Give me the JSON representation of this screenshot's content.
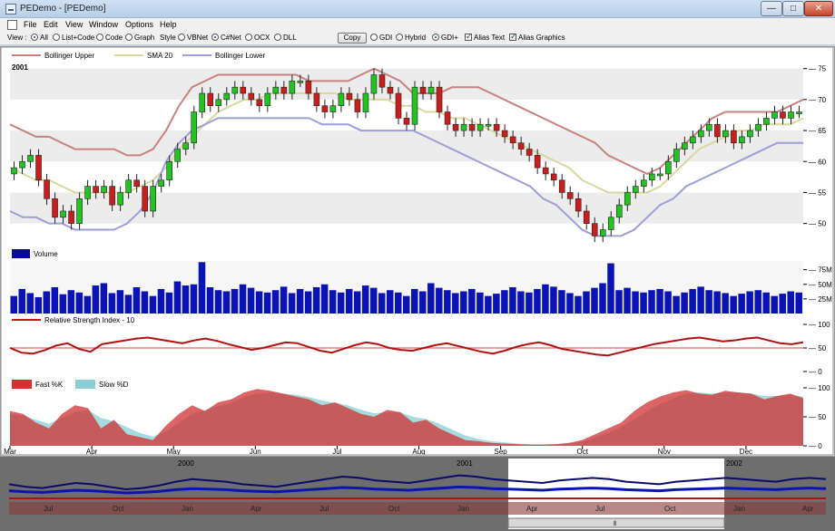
{
  "window": {
    "title": "PEDemo - [PEDemo]",
    "controls": {
      "minimize": "—",
      "maximize": "□",
      "close": "✕"
    }
  },
  "menu": [
    "File",
    "Edit",
    "View",
    "Window",
    "Options",
    "Help"
  ],
  "toolbar": {
    "view_label": "View :",
    "view_options": [
      {
        "label": "All",
        "selected": true
      },
      {
        "label": "List+Code",
        "selected": false
      },
      {
        "label": "Code",
        "selected": false
      },
      {
        "label": "Graph",
        "selected": false
      }
    ],
    "style_label": "Style :",
    "style_options": [
      {
        "label": "VBNet",
        "selected": false
      },
      {
        "label": "C#Net",
        "selected": true
      },
      {
        "label": "OCX",
        "selected": false
      },
      {
        "label": "DLL",
        "selected": false
      }
    ],
    "copy_label": "Copy",
    "render_options": [
      {
        "label": "GDI",
        "selected": false
      },
      {
        "label": "Hybrid",
        "selected": false
      },
      {
        "label": "GDI+",
        "selected": true
      }
    ],
    "alias_text_label": "Alias Text",
    "alias_text_checked": true,
    "alias_graphics_label": "Alias Graphics",
    "alias_graphics_checked": true
  },
  "chart_data": [
    {
      "type": "line",
      "panel": "price",
      "year_label": "2001",
      "legend": [
        "Bollinger Upper",
        "SMA 20",
        "Bollinger Lower"
      ],
      "ylim": [
        46,
        77
      ],
      "y_ticks": [
        50,
        55,
        60,
        65,
        70,
        75
      ],
      "x_months": [
        "Mar",
        "Apr",
        "May",
        "Jun",
        "Jul",
        "Aug",
        "Sep",
        "Oct",
        "Nov",
        "Dec"
      ],
      "close": [
        59,
        60,
        61,
        57,
        54,
        51,
        52,
        50,
        54,
        56,
        55,
        56,
        53,
        55,
        57,
        56,
        52,
        56,
        57,
        60,
        62,
        63,
        68,
        71,
        69,
        70,
        71,
        72,
        71,
        70,
        69,
        71,
        72,
        71,
        73,
        73,
        71,
        69,
        68,
        69,
        71,
        70,
        68,
        71,
        74,
        72,
        71,
        67,
        66,
        72,
        71,
        72,
        68,
        66,
        65,
        66,
        65,
        66,
        66,
        65,
        64,
        63,
        62,
        61,
        59,
        58,
        57,
        55,
        54,
        52,
        50,
        48,
        49,
        51,
        53,
        55,
        56,
        57,
        58,
        58,
        60,
        62,
        63,
        64,
        65,
        66,
        64,
        65,
        63,
        64,
        65,
        66,
        67,
        68,
        67,
        68,
        68
      ],
      "series": [
        {
          "name": "Bollinger Upper",
          "color": "#c98080",
          "values": [
            66,
            65,
            64,
            64,
            63,
            62,
            62,
            62,
            62,
            61,
            61,
            62,
            65,
            69,
            72,
            73,
            74,
            74,
            74,
            74,
            74,
            74,
            74,
            73,
            73,
            73,
            73,
            74,
            75,
            74,
            73,
            71,
            71,
            71,
            72,
            72,
            72,
            71,
            70,
            69,
            68,
            67,
            66,
            65,
            64,
            63,
            61,
            60,
            59,
            58,
            59,
            61,
            63,
            65,
            67,
            68,
            68,
            68,
            68,
            68,
            69,
            70
          ]
        },
        {
          "name": "SMA 20",
          "color": "#d8d8a0",
          "values": [
            59,
            58,
            57,
            57,
            56,
            55,
            55,
            55,
            55,
            55,
            56,
            57,
            59,
            62,
            64,
            66,
            68,
            69,
            70,
            70,
            71,
            71,
            71,
            71,
            71,
            71,
            70,
            70,
            70,
            70,
            69,
            69,
            68,
            68,
            67,
            67,
            66,
            65,
            64,
            63,
            62,
            61,
            60,
            59,
            57,
            56,
            55,
            55,
            55,
            55,
            56,
            58,
            60,
            62,
            63,
            64,
            65,
            65,
            66,
            66,
            66,
            67
          ]
        },
        {
          "name": "Bollinger Lower",
          "color": "#9e9ed8",
          "values": [
            52,
            51,
            51,
            50,
            50,
            49,
            49,
            49,
            49,
            50,
            52,
            55,
            60,
            63,
            65,
            66,
            67,
            67,
            67,
            67,
            67,
            67,
            67,
            67,
            66,
            66,
            66,
            65,
            65,
            65,
            65,
            65,
            64,
            63,
            62,
            61,
            60,
            59,
            58,
            57,
            56,
            54,
            53,
            51,
            49,
            48,
            48,
            48,
            49,
            51,
            53,
            54,
            56,
            57,
            58,
            59,
            60,
            61,
            62,
            63,
            63,
            63
          ]
        }
      ]
    },
    {
      "type": "bar",
      "panel": "volume",
      "legend": [
        "Volume"
      ],
      "y_ticks": [
        "25M",
        "50M",
        "75M"
      ],
      "ylim": [
        0,
        90
      ],
      "values": [
        30,
        42,
        35,
        28,
        38,
        45,
        33,
        40,
        36,
        30,
        48,
        52,
        35,
        40,
        32,
        45,
        38,
        30,
        42,
        36,
        55,
        48,
        50,
        88,
        45,
        40,
        38,
        42,
        50,
        44,
        38,
        36,
        40,
        46,
        35,
        42,
        38,
        45,
        50,
        40,
        36,
        42,
        38,
        48,
        44,
        35,
        40,
        36,
        30,
        42,
        38,
        52,
        44,
        40,
        35,
        38,
        42,
        36,
        30,
        34,
        40,
        45,
        38,
        36,
        42,
        50,
        46,
        40,
        35,
        30,
        38,
        44,
        52,
        86,
        40,
        44,
        38,
        36,
        40,
        42,
        38,
        30,
        36,
        42,
        46,
        40,
        38,
        35,
        30,
        34,
        38,
        40,
        36,
        30,
        34,
        38,
        36
      ]
    },
    {
      "type": "line",
      "panel": "rsi",
      "legend": [
        "Relative Strength Index - 10"
      ],
      "ylim": [
        0,
        100
      ],
      "y_ticks": [
        0,
        50,
        100
      ],
      "values": [
        50,
        40,
        38,
        45,
        55,
        60,
        48,
        42,
        58,
        62,
        66,
        70,
        72,
        68,
        64,
        60,
        66,
        70,
        65,
        58,
        52,
        46,
        50,
        56,
        62,
        60,
        52,
        44,
        40,
        48,
        56,
        62,
        58,
        50,
        46,
        44,
        50,
        56,
        60,
        54,
        48,
        42,
        38,
        44,
        52,
        58,
        62,
        56,
        48,
        44,
        40,
        36,
        34,
        40,
        46,
        52,
        58,
        62,
        66,
        70,
        72,
        68,
        64,
        66,
        70,
        72,
        66,
        60,
        58,
        62
      ]
    },
    {
      "type": "area",
      "panel": "stochastic",
      "legend": [
        "Fast %K",
        "Slow %D"
      ],
      "ylim": [
        0,
        100
      ],
      "y_ticks": [
        0,
        50,
        100
      ],
      "series": [
        {
          "name": "Fast %K",
          "color": "#d03030",
          "values": [
            60,
            55,
            40,
            30,
            55,
            70,
            65,
            30,
            45,
            20,
            15,
            10,
            35,
            55,
            70,
            60,
            75,
            80,
            92,
            98,
            95,
            90,
            85,
            80,
            70,
            75,
            65,
            55,
            50,
            62,
            58,
            40,
            45,
            30,
            20,
            10,
            8,
            5,
            4,
            3,
            2,
            2,
            3,
            5,
            10,
            20,
            30,
            40,
            60,
            75,
            85,
            92,
            96,
            90,
            88,
            95,
            92,
            90,
            80,
            86,
            90,
            82
          ]
        },
        {
          "name": "Slow %D",
          "color": "#88d0d4",
          "values": [
            55,
            52,
            45,
            38,
            48,
            58,
            62,
            48,
            42,
            32,
            22,
            16,
            25,
            40,
            55,
            62,
            68,
            74,
            84,
            90,
            92,
            90,
            88,
            84,
            78,
            74,
            70,
            62,
            56,
            58,
            58,
            50,
            46,
            38,
            28,
            18,
            12,
            8,
            6,
            4,
            3,
            3,
            3,
            4,
            7,
            14,
            22,
            32,
            46,
            60,
            72,
            82,
            90,
            92,
            90,
            92,
            92,
            90,
            86,
            86,
            88,
            85
          ]
        }
      ]
    },
    {
      "type": "line",
      "panel": "navigator",
      "year_labels": [
        "2000",
        "2001",
        "2002"
      ],
      "x_months": [
        "Jul",
        "Oct",
        "Jan",
        "Apr",
        "Jul",
        "Oct",
        "Jan",
        "Apr",
        "Jul",
        "Oct",
        "Jan",
        "Apr"
      ],
      "values": [
        58,
        56,
        55,
        57,
        59,
        58,
        56,
        54,
        55,
        57,
        60,
        62,
        61,
        60,
        58,
        57,
        56,
        58,
        60,
        62,
        64,
        63,
        61,
        60,
        59,
        61,
        63,
        65,
        64,
        62,
        61,
        60,
        59,
        61,
        62,
        63,
        62,
        60,
        59,
        58,
        60,
        61,
        62,
        63,
        62,
        61,
        60,
        62,
        63,
        62
      ]
    }
  ]
}
